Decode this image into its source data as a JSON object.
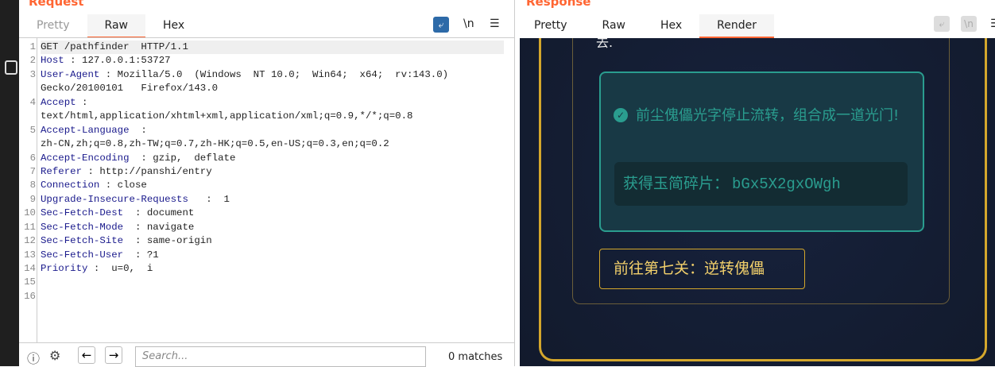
{
  "request": {
    "title": "Request",
    "tabs": [
      "Pretty",
      "Raw",
      "Hex"
    ],
    "active_tab": "Raw",
    "toolbar": {
      "wrap": "wrap-icon",
      "newline": "\\n",
      "menu": "☰"
    },
    "lines": [
      {
        "n": "1",
        "text": "GET /pathfinder  HTTP/1.1"
      },
      {
        "n": "2",
        "key": "Host",
        "text": " : 127.0.0.1:53727"
      },
      {
        "n": "3",
        "key": "User-Agent",
        "text": " : Mozilla/5.0  (Windows  NT 10.0;  Win64;  x64;  rv:143.0)"
      },
      {
        "n": "",
        "text": "Gecko/20100101   Firefox/143.0"
      },
      {
        "n": "4",
        "key": "Accept",
        "text": " :"
      },
      {
        "n": "",
        "text": "text/html,application/xhtml+xml,application/xml;q=0.9,*/*;q=0.8"
      },
      {
        "n": "5",
        "key": "Accept-Language",
        "text": "  :"
      },
      {
        "n": "",
        "text": "zh-CN,zh;q=0.8,zh-TW;q=0.7,zh-HK;q=0.5,en-US;q=0.3,en;q=0.2"
      },
      {
        "n": "6",
        "key": "Accept-Encoding",
        "text": "  : gzip,  deflate"
      },
      {
        "n": "7",
        "key": "Referer",
        "text": " : http://panshi/entry"
      },
      {
        "n": "8",
        "key": "Connection",
        "text": " : close"
      },
      {
        "n": "9",
        "key": "Upgrade-Insecure-Requests",
        "text": "   :  1"
      },
      {
        "n": "10",
        "key": "Sec-Fetch-Dest",
        "text": "  : document"
      },
      {
        "n": "11",
        "key": "Sec-Fetch-Mode",
        "text": "  : navigate"
      },
      {
        "n": "12",
        "key": "Sec-Fetch-Site",
        "text": "  : same-origin"
      },
      {
        "n": "13",
        "key": "Sec-Fetch-User",
        "text": "  : ?1"
      },
      {
        "n": "14",
        "key": "Priority",
        "text": " :  u=0,  i"
      },
      {
        "n": "15",
        "text": ""
      },
      {
        "n": "16",
        "text": ""
      }
    ],
    "search": {
      "placeholder": "Search...",
      "matches": "0 matches"
    }
  },
  "response": {
    "title": "Response",
    "tabs": [
      "Pretty",
      "Raw",
      "Hex",
      "Render"
    ],
    "active_tab": "Render",
    "newline": "\\n",
    "render": {
      "partial_text": "去.",
      "success_message": "前尘傀儡光字停止流转，组合成一道光门!",
      "shard_label": "获得玉简碎片：",
      "shard_value": "bGx5X2gxOWgh",
      "next_button": "前往第七关：逆转傀儡",
      "colors": {
        "gold": "#d4a72c",
        "teal": "#2a9d8f",
        "bg": "#141e33"
      }
    }
  }
}
